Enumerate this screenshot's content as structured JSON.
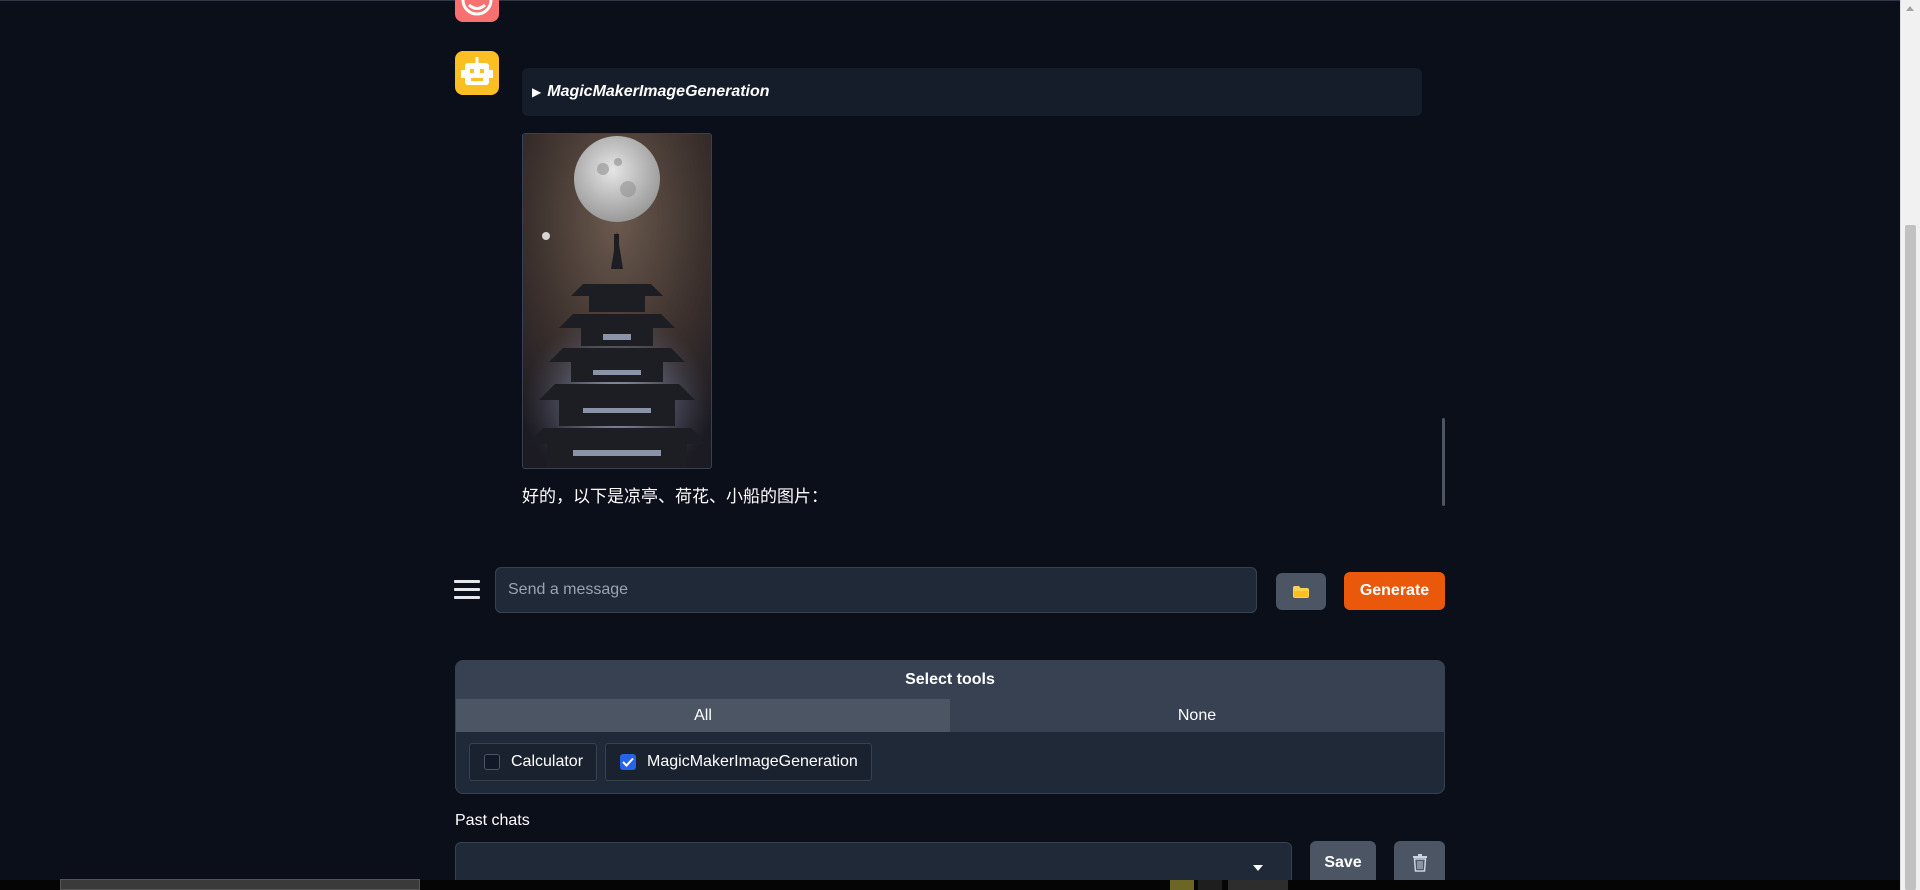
{
  "chat": {
    "tool_call_label": "MagicMakerImageGeneration",
    "reply_text": "好的，以下是凉亭、荷花、小船的图片："
  },
  "input": {
    "placeholder": "Send a message",
    "generate_label": "Generate"
  },
  "tools": {
    "title": "Select tools",
    "tab_all": "All",
    "tab_none": "None",
    "options": [
      {
        "label": "Calculator",
        "checked": false
      },
      {
        "label": "MagicMakerImageGeneration",
        "checked": true
      }
    ]
  },
  "past_chats": {
    "label": "Past chats",
    "save_label": "Save"
  },
  "colors": {
    "background": "#0b0f19",
    "accent": "#ea580c",
    "checkbox_checked": "#2563eb",
    "user_avatar": "#f87171",
    "bot_avatar": "#fbbf24"
  },
  "icons": {
    "menu": "hamburger-icon",
    "folder": "folder-icon",
    "trash": "trash-icon",
    "dropdown": "chevron-down-icon"
  }
}
